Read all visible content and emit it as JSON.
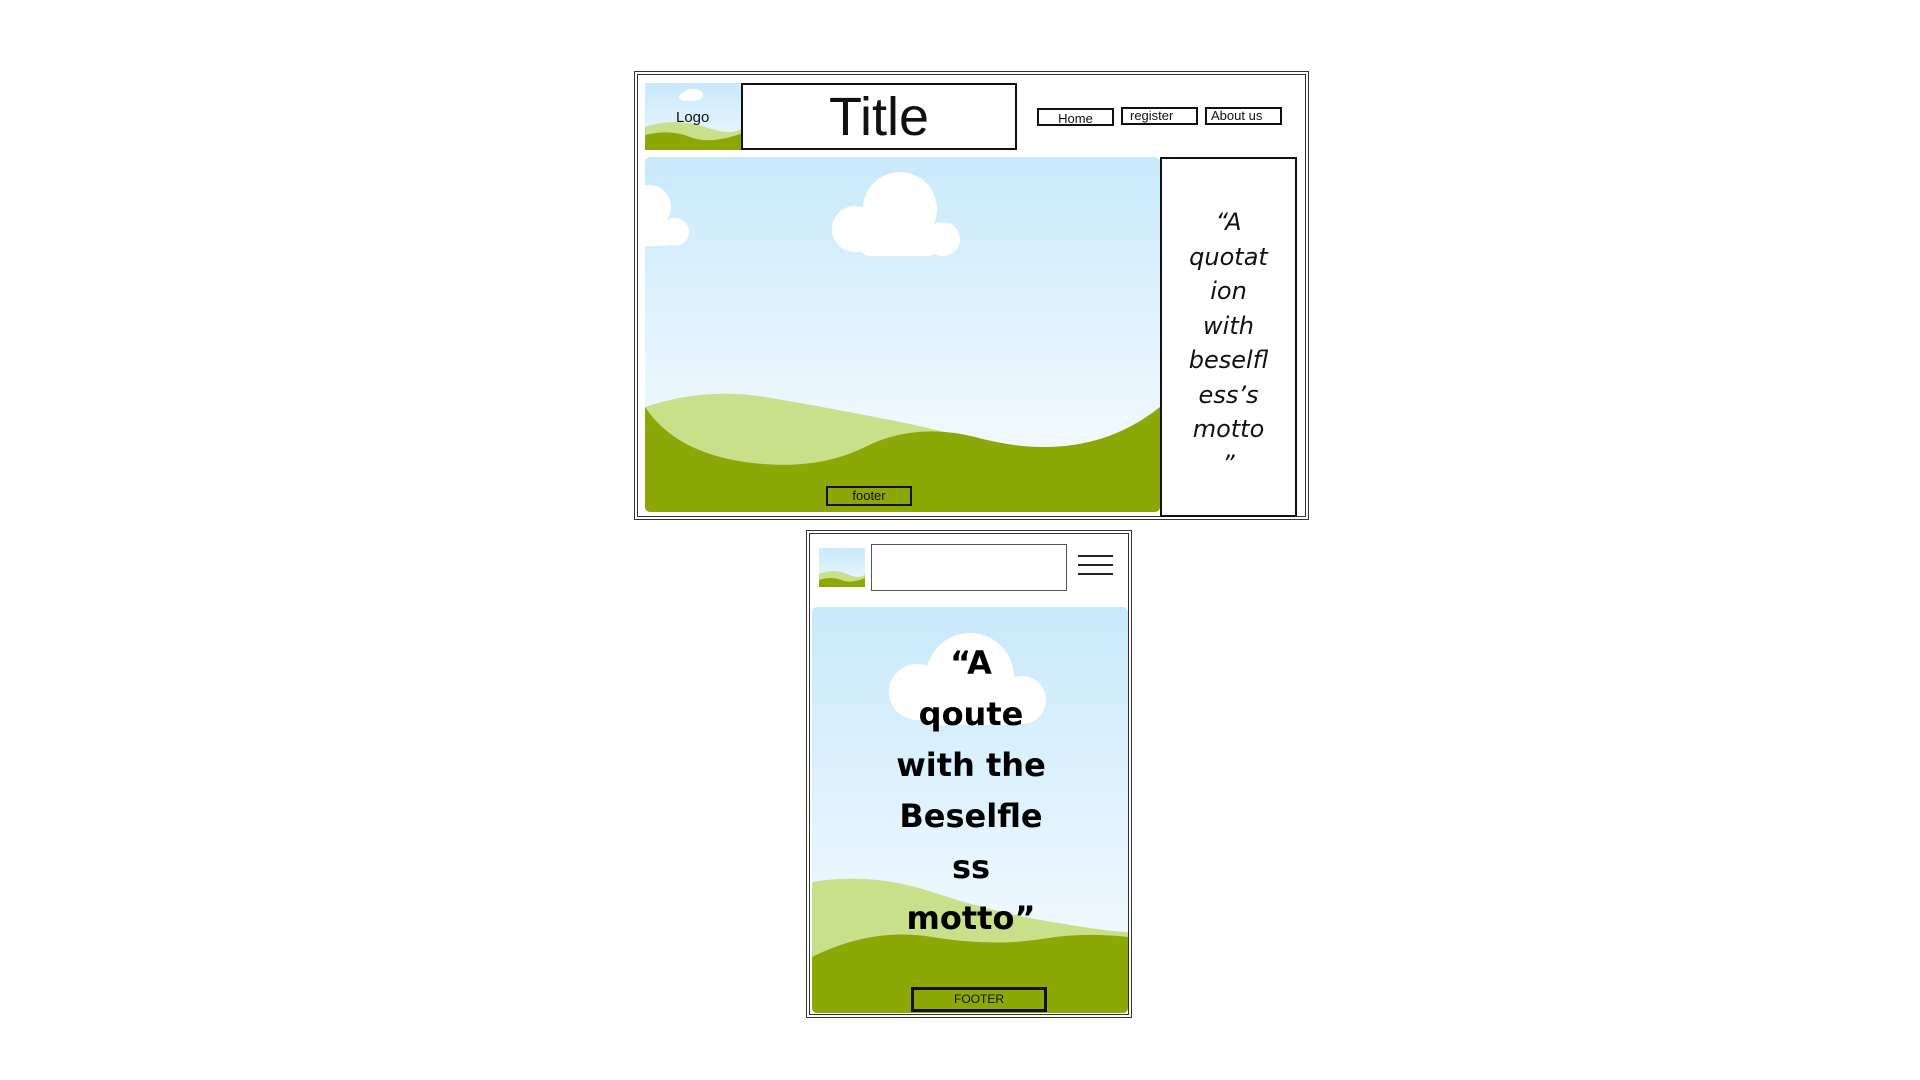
{
  "desktop": {
    "logo_label": "Logo",
    "title": "Title",
    "nav": [
      "Home",
      "register",
      "About us"
    ],
    "quote": "“A\nquotat\nion\nwith\nbeselfl\ness’s\nmotto\n”",
    "footer": "footer"
  },
  "mobile": {
    "quote": "“A\nqoute\nwith the\nBeselfle\nss\nmotto”",
    "footer": "FOOTER",
    "menu_icon": "hamburger-icon"
  },
  "colors": {
    "sky_top": "#c8e9fc",
    "sky_bottom": "#eef8fe",
    "hill_light": "#c8e08a",
    "hill_dark": "#8ca806",
    "cloud": "#ffffff",
    "border": "#111111"
  }
}
